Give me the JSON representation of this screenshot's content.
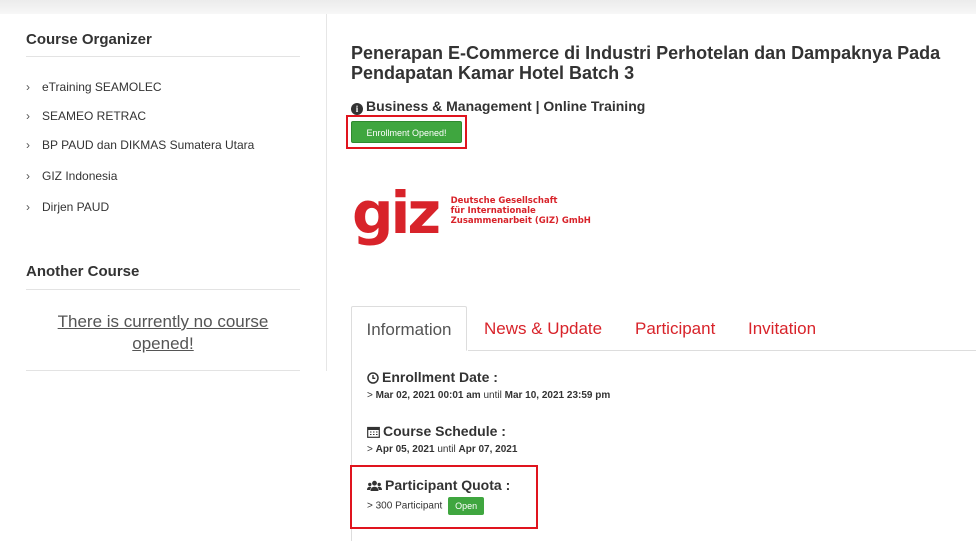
{
  "sidebar": {
    "organizer_title": "Course Organizer",
    "organizers": [
      "eTraining SEAMOLEC",
      "SEAMEO RETRAC",
      "BP PAUD dan DIKMAS Sumatera Utara",
      "GIZ Indonesia",
      "Dirjen PAUD"
    ],
    "another_title": "Another Course",
    "no_course_text": "There is currently no course opened!"
  },
  "course": {
    "title": "Penerapan E-Commerce di Industri Perhotelan dan Dampaknya Pada Pendapatan Kamar Hotel Batch 3",
    "category": "Business & Management | Online Training",
    "enroll_label": "Enrollment Opened!",
    "logo": {
      "mark": "giz",
      "line1": "Deutsche Gesellschaft",
      "line2": "für Internationale",
      "line3": "Zusammenarbeit (GIZ) GmbH",
      "color": "#d8232a"
    }
  },
  "tabs": [
    "Information",
    "News & Update",
    "Participant",
    "Invitation"
  ],
  "info": {
    "enroll_title": "Enrollment Date :",
    "enroll_start": "Mar 02, 2021 00:01 am",
    "until1": "until",
    "enroll_end": "Mar 10, 2021 23:59 pm",
    "schedule_title": "Course Schedule :",
    "schedule_start": "Apr 05, 2021",
    "until2": "until",
    "schedule_end": "Apr 07, 2021",
    "quota_title": "Participant Quota :",
    "quota_value": "300 Participant",
    "quota_status": "Open",
    "prefix": ">"
  },
  "colors": {
    "accent_red": "#d8232a",
    "button_green": "#3fa63f",
    "highlight_red": "#e0141e"
  }
}
